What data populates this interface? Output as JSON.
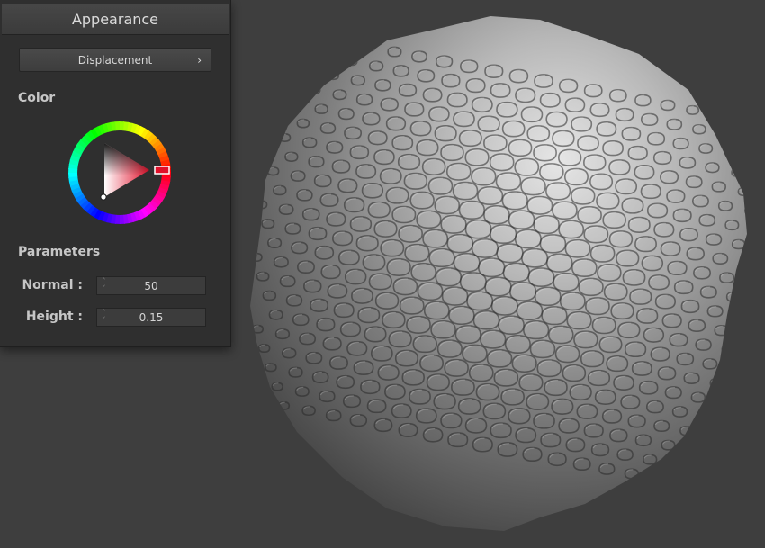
{
  "panel": {
    "title": "Appearance",
    "dropdown": {
      "label": "Displacement",
      "chevron": "›"
    },
    "color_section": "Color",
    "color_wheel": {
      "selected_hue": "#e0102a",
      "icon": "color-wheel-icon"
    },
    "parameters_section": "Parameters",
    "parameters": [
      {
        "label": "Normal :",
        "value": "50"
      },
      {
        "label": "Height :",
        "value": "0.15"
      }
    ]
  },
  "viewport": {
    "background": "#3e3e3e",
    "object": "scaled sphere"
  }
}
